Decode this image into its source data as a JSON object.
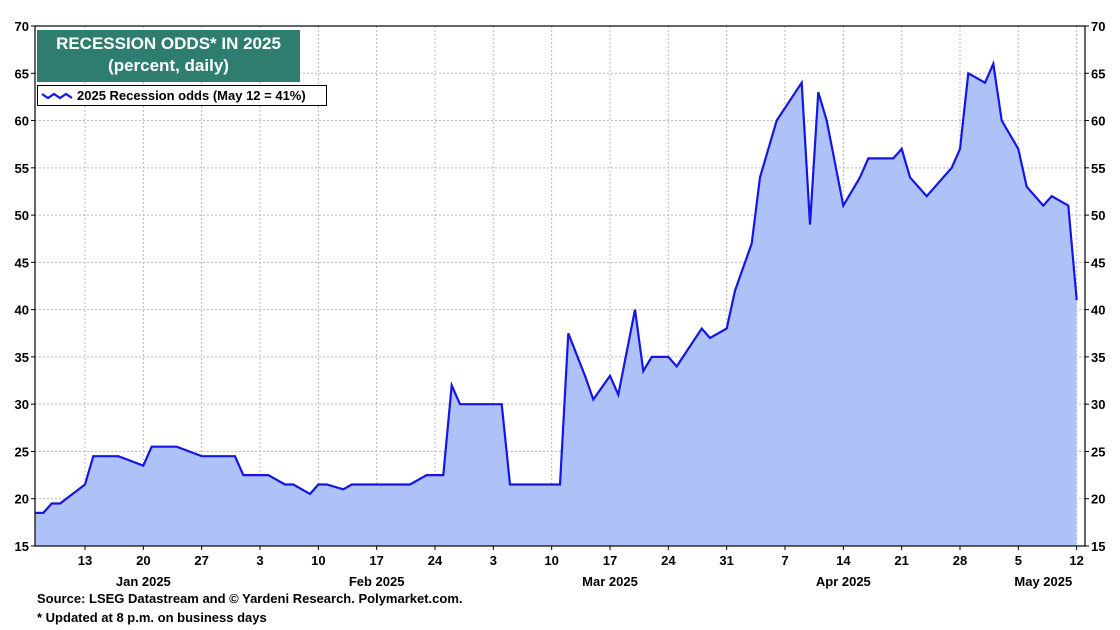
{
  "title_line1": "RECESSION ODDS* IN 2025",
  "title_line2": "(percent, daily)",
  "legend_label": "2025 Recession odds (May 12 = 41%)",
  "source": "Source: LSEG Datastream and © Yardeni Research. Polymarket.com.",
  "footnote": "* Updated at 8 p.m. on business days",
  "colors": {
    "line": "#1515e6",
    "fill": "#aec2f7",
    "title_bg": "#2e7d6e"
  },
  "chart_data": {
    "type": "area",
    "title": "RECESSION ODDS* IN 2025",
    "subtitle": "(percent, daily)",
    "ylim": [
      15,
      70
    ],
    "yticks": [
      15,
      20,
      25,
      30,
      35,
      40,
      45,
      50,
      55,
      60,
      65,
      70
    ],
    "xlim": [
      "2025-01-07",
      "2025-05-13"
    ],
    "x_day_ticks": [
      {
        "date": "2025-01-13",
        "label": "13"
      },
      {
        "date": "2025-01-20",
        "label": "20"
      },
      {
        "date": "2025-01-27",
        "label": "27"
      },
      {
        "date": "2025-02-03",
        "label": "3"
      },
      {
        "date": "2025-02-10",
        "label": "10"
      },
      {
        "date": "2025-02-17",
        "label": "17"
      },
      {
        "date": "2025-02-24",
        "label": "24"
      },
      {
        "date": "2025-03-03",
        "label": "3"
      },
      {
        "date": "2025-03-10",
        "label": "10"
      },
      {
        "date": "2025-03-17",
        "label": "17"
      },
      {
        "date": "2025-03-24",
        "label": "24"
      },
      {
        "date": "2025-03-31",
        "label": "31"
      },
      {
        "date": "2025-04-07",
        "label": "7"
      },
      {
        "date": "2025-04-14",
        "label": "14"
      },
      {
        "date": "2025-04-21",
        "label": "21"
      },
      {
        "date": "2025-04-28",
        "label": "28"
      },
      {
        "date": "2025-05-05",
        "label": "5"
      },
      {
        "date": "2025-05-12",
        "label": "12"
      }
    ],
    "x_month_labels": [
      {
        "date": "2025-01-20",
        "label": "Jan 2025"
      },
      {
        "date": "2025-02-17",
        "label": "Feb 2025"
      },
      {
        "date": "2025-03-17",
        "label": "Mar 2025"
      },
      {
        "date": "2025-04-14",
        "label": "Apr 2025"
      },
      {
        "date": "2025-05-08",
        "label": "May 2025"
      }
    ],
    "grid": true,
    "legend_position": "top-left",
    "series": [
      {
        "name": "2025 Recession odds (May 12 = 41%)",
        "points": [
          [
            "2025-01-07",
            18.5
          ],
          [
            "2025-01-08",
            18.5
          ],
          [
            "2025-01-09",
            19.5
          ],
          [
            "2025-01-10",
            19.5
          ],
          [
            "2025-01-13",
            21.5
          ],
          [
            "2025-01-14",
            24.5
          ],
          [
            "2025-01-16",
            24.5
          ],
          [
            "2025-01-17",
            24.5
          ],
          [
            "2025-01-20",
            23.5
          ],
          [
            "2025-01-21",
            25.5
          ],
          [
            "2025-01-24",
            25.5
          ],
          [
            "2025-01-27",
            24.5
          ],
          [
            "2025-01-28",
            24.5
          ],
          [
            "2025-01-31",
            24.5
          ],
          [
            "2025-02-01",
            22.5
          ],
          [
            "2025-02-04",
            22.5
          ],
          [
            "2025-02-06",
            21.5
          ],
          [
            "2025-02-07",
            21.5
          ],
          [
            "2025-02-09",
            20.5
          ],
          [
            "2025-02-10",
            21.5
          ],
          [
            "2025-02-11",
            21.5
          ],
          [
            "2025-02-13",
            21.0
          ],
          [
            "2025-02-14",
            21.5
          ],
          [
            "2025-02-17",
            21.5
          ],
          [
            "2025-02-21",
            21.5
          ],
          [
            "2025-02-23",
            22.5
          ],
          [
            "2025-02-25",
            22.5
          ],
          [
            "2025-02-26",
            32.0
          ],
          [
            "2025-02-27",
            30.0
          ],
          [
            "2025-02-28",
            30.0
          ],
          [
            "2025-03-04",
            30.0
          ],
          [
            "2025-03-05",
            21.5
          ],
          [
            "2025-03-06",
            21.5
          ],
          [
            "2025-03-11",
            21.5
          ],
          [
            "2025-03-12",
            37.5
          ],
          [
            "2025-03-14",
            33.0
          ],
          [
            "2025-03-15",
            30.5
          ],
          [
            "2025-03-17",
            33.0
          ],
          [
            "2025-03-18",
            31.0
          ],
          [
            "2025-03-20",
            40.0
          ],
          [
            "2025-03-21",
            33.5
          ],
          [
            "2025-03-22",
            35.0
          ],
          [
            "2025-03-24",
            35.0
          ],
          [
            "2025-03-25",
            34.0
          ],
          [
            "2025-03-28",
            38.0
          ],
          [
            "2025-03-29",
            37.0
          ],
          [
            "2025-03-31",
            38.0
          ],
          [
            "2025-04-01",
            42.0
          ],
          [
            "2025-04-03",
            47.0
          ],
          [
            "2025-04-04",
            54.0
          ],
          [
            "2025-04-06",
            60.0
          ],
          [
            "2025-04-09",
            64.0
          ],
          [
            "2025-04-10",
            49.0
          ],
          [
            "2025-04-11",
            63.0
          ],
          [
            "2025-04-12",
            60.0
          ],
          [
            "2025-04-14",
            51.0
          ],
          [
            "2025-04-16",
            54.0
          ],
          [
            "2025-04-17",
            56.0
          ],
          [
            "2025-04-20",
            56.0
          ],
          [
            "2025-04-21",
            57.0
          ],
          [
            "2025-04-22",
            54.0
          ],
          [
            "2025-04-24",
            52.0
          ],
          [
            "2025-04-26",
            54.0
          ],
          [
            "2025-04-27",
            55.0
          ],
          [
            "2025-04-28",
            57.0
          ],
          [
            "2025-04-29",
            65.0
          ],
          [
            "2025-05-01",
            64.0
          ],
          [
            "2025-05-02",
            66.0
          ],
          [
            "2025-05-03",
            60.0
          ],
          [
            "2025-05-05",
            57.0
          ],
          [
            "2025-05-06",
            53.0
          ],
          [
            "2025-05-08",
            51.0
          ],
          [
            "2025-05-09",
            52.0
          ],
          [
            "2025-05-11",
            51.0
          ],
          [
            "2025-05-12",
            41.0
          ]
        ]
      }
    ]
  }
}
